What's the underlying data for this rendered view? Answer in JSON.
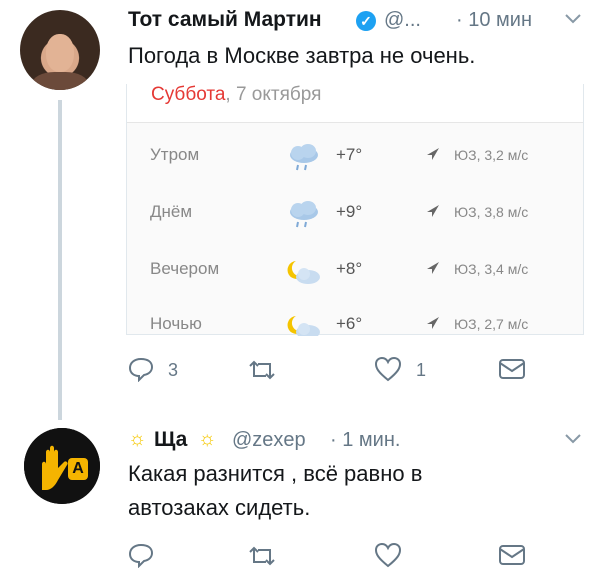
{
  "tweet1": {
    "author_name": "Тот самый Мартин",
    "handle": "@...",
    "time": "· 10 мин",
    "text": "Погода в Москве завтра не очень.",
    "card": {
      "day": "Суббота",
      "date": ", 7 октября",
      "rows": [
        {
          "label": "Утром",
          "icon": "rain-cloud-icon",
          "temp": "+7°",
          "wind": "ЮЗ, 3,2 м/с"
        },
        {
          "label": "Днём",
          "icon": "rain-cloud-icon",
          "temp": "+9°",
          "wind": "ЮЗ, 3,8 м/с"
        },
        {
          "label": "Вечером",
          "icon": "moon-cloud-icon",
          "temp": "+8°",
          "wind": "ЮЗ, 3,4 м/с"
        },
        {
          "label": "Ночью",
          "icon": "moon-cloud-icon",
          "temp": "+6°",
          "wind": "ЮЗ, 2,7 м/с"
        }
      ]
    },
    "actions": {
      "reply_count": "3",
      "retweet_count": "",
      "like_count": "1"
    }
  },
  "tweet2": {
    "author_name": "Ща",
    "handle": "@zexep",
    "time": "· 1 мин.",
    "text_line1": "Какая разнится , всё равно в",
    "text_line2": "автозаках сидеть.",
    "avatar_badge": "A"
  },
  "colors": {
    "accent": "#1da1f2",
    "muted": "#657786",
    "card_day": "#e53935",
    "thread_line": "#ccd6dd"
  }
}
